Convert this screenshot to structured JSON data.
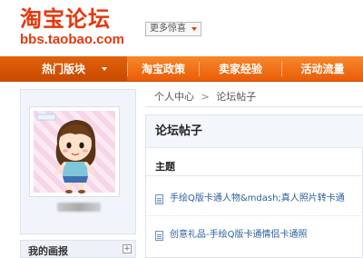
{
  "header": {
    "logo_title": "淘宝论坛",
    "logo_url": "bbs.taobao.com",
    "more_fun_label": "更多惊喜"
  },
  "nav": {
    "items": [
      {
        "label": "热门版块",
        "active": true,
        "has_dropdown": true
      },
      {
        "label": "淘宝政策",
        "active": false
      },
      {
        "label": "卖家经验",
        "active": false
      },
      {
        "label": "活动流量",
        "active": false
      }
    ]
  },
  "breadcrumb": {
    "parent": "个人中心",
    "separator": ">",
    "current": "论坛帖子"
  },
  "sidebar": {
    "bottom_label": "我的画报",
    "expand_symbol": "+"
  },
  "panel": {
    "title": "论坛帖子",
    "column_header": "主题",
    "posts": [
      {
        "title": "手绘Q版卡通人物&mdash;真人照片转卡通"
      },
      {
        "title": "创意礼品-手绘Q版卡通情侣卡通照"
      }
    ]
  },
  "colors": {
    "brand": "#e4380d",
    "nav_bg": "#ef6d17",
    "link": "#2b5f9e"
  }
}
